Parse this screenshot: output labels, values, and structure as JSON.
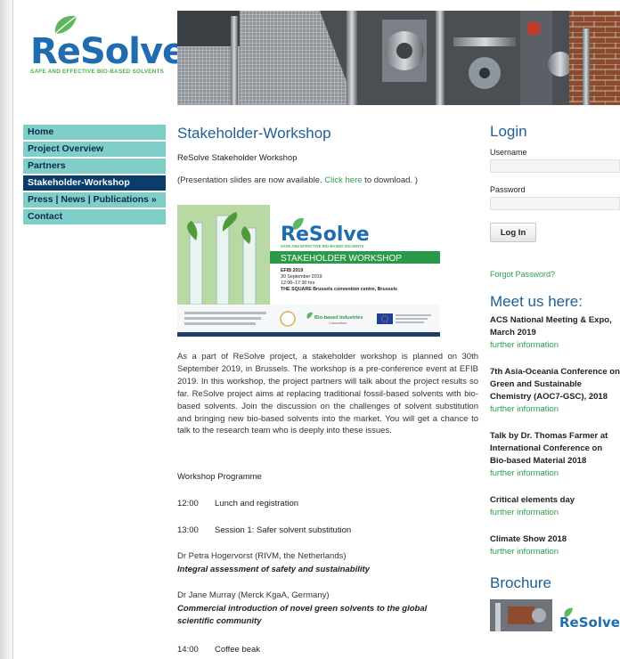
{
  "logo": {
    "word_re": "Re",
    "word_solve": "Solve",
    "tagline": "SAFE AND EFFECTIVE BIO-BASED SOLVENTS"
  },
  "nav": {
    "items": [
      {
        "label": "Home"
      },
      {
        "label": "Project Overview"
      },
      {
        "label": "Partners"
      },
      {
        "label": "Stakeholder-Workshop"
      },
      {
        "label": "Press | News | Publications »"
      },
      {
        "label": "Contact"
      }
    ],
    "active_index": 3
  },
  "main": {
    "title": "Stakeholder-Workshop",
    "subtitle": "ReSolve Stakeholder Workshop",
    "slides_prefix": "(Presentation slides are now available. ",
    "slides_link": "Click here",
    "slides_suffix": " to download. )",
    "poster": {
      "logo_re": "Re",
      "logo_solve": "Solve",
      "tagline": "SAFE AND EFFECTIVE BIO-BASED SOLVENTS",
      "banner": "STAKEHOLDER WORKSHOP",
      "line1": "EFIB 2019",
      "line2": "30 September 2019",
      "line3": "12:00–17:30 hrs",
      "line4": "THE SQUARE Brussels convention centre, Brussels",
      "bbi": "Bio-based Industries",
      "bbi_sub": "Consortium"
    },
    "body": "As a part of ReSolve project, a stakeholder workshop is planned on 30th September 2019, in Brussels. The workshop is a pre-conference event at EFIB 2019. In this workshop, the project partners will talk about the project results so far. ReSolve project aims at replacing traditional fossil-based solvents with bio-based solvents. Join the discussion on the challenges of solvent substitution and bringing new bio-based solvents into the market. You will get a chance to talk to the research team who is deeply into these issues.",
    "programme_heading": "Workshop Programme",
    "programme": [
      {
        "time": "12:00",
        "label": "Lunch and registration"
      },
      {
        "time": "13:00",
        "label": "Session 1: Safer solvent substitution"
      }
    ],
    "speakers": [
      {
        "name": "Dr Petra Hogervorst (RIVM, the Netherlands)",
        "talk": "Integral assessment of safety and sustainability"
      },
      {
        "name": "Dr Jane Murray (Merck KgaA, Germany)",
        "talk": "Commercial introduction of novel green solvents to the global scientific community"
      }
    ],
    "coffee": {
      "time": "14:00",
      "label": "Coffee beak"
    }
  },
  "sidebar": {
    "login_title": "Login",
    "username_label": "Username",
    "password_label": "Password",
    "login_button": "Log In",
    "forgot": "Forgot Password?",
    "meet_title": "Meet us here:",
    "events": [
      {
        "title": "ACS National Meeting & Expo, March 2019",
        "link": "further information"
      },
      {
        "title": "7th Asia-Oceania Conference on Green and Sustainable Chemistry (AOC7-GSC), 2018",
        "link": "further information"
      },
      {
        "title": "Talk by Dr. Thomas Farmer at International Conference on Bio-based Material 2018",
        "link": "further information"
      },
      {
        "title": "Critical elements day",
        "link": "further information"
      },
      {
        "title": "Climate Show 2018",
        "link": "further information"
      }
    ],
    "brochure_title": "Brochure",
    "brochure_logo": "ReSolve"
  },
  "colors": {
    "nav_bg": "#7fcfc8",
    "nav_active": "#0b3d6b",
    "heading_blue": "#1f5f96",
    "link_green": "#2aa24a",
    "brand_blue": "#1f6db0"
  }
}
